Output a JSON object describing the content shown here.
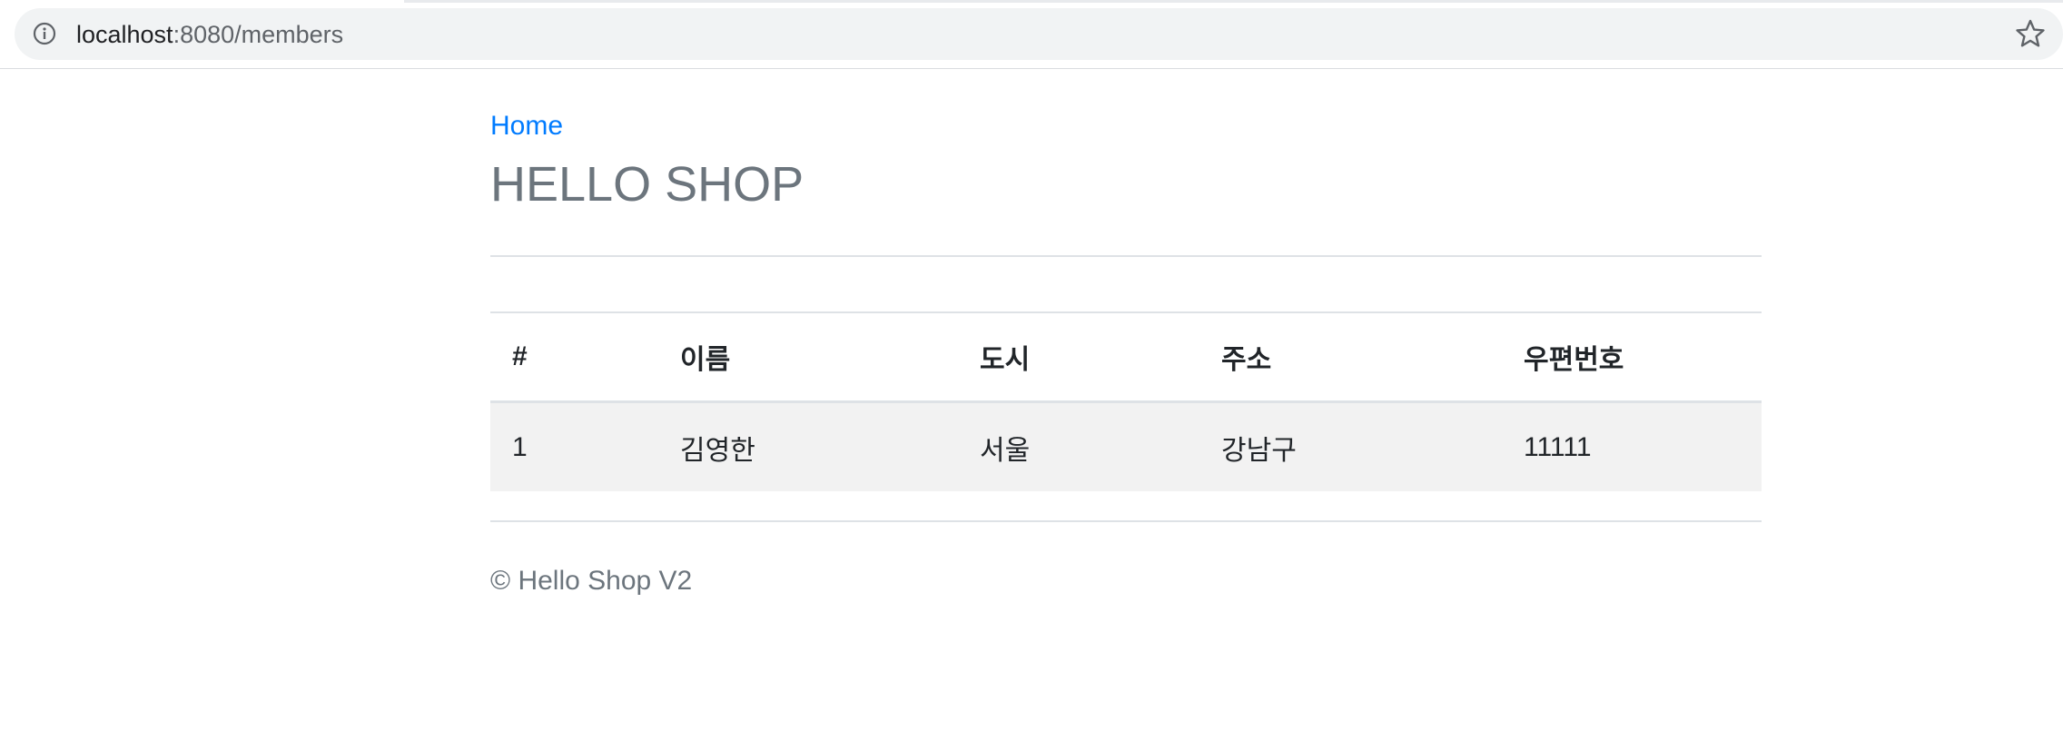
{
  "browser": {
    "url_host": "localhost",
    "url_path": ":8080/members",
    "info_icon": "info-icon",
    "bookmark_icon": "star-icon"
  },
  "header": {
    "home_link": "Home",
    "title": "HELLO SHOP"
  },
  "table": {
    "columns": [
      "#",
      "이름",
      "도시",
      "주소",
      "우편번호"
    ],
    "rows": [
      [
        "1",
        "김영한",
        "서울",
        "강남구",
        "11111"
      ]
    ]
  },
  "footer": {
    "text": "© Hello Shop V2"
  },
  "colors": {
    "link": "#007bff",
    "muted": "#6c757d",
    "row_stripe": "#f2f2f2",
    "border": "#dee2e6"
  }
}
